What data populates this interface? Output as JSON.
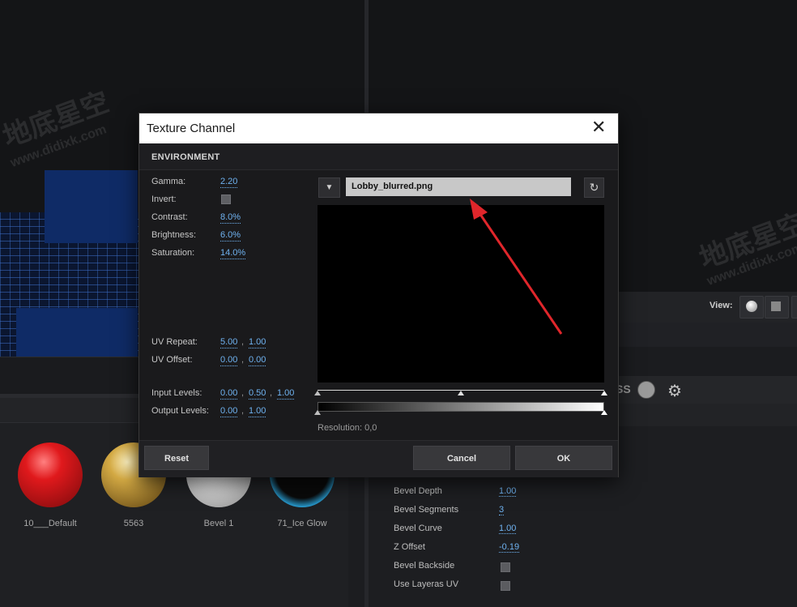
{
  "dialog": {
    "title": "Texture Channel",
    "close_glyph": "✕",
    "section": "ENVIRONMENT",
    "gamma_label": "Gamma:",
    "gamma": "2.20",
    "invert_label": "Invert:",
    "invert_checked": false,
    "contrast_label": "Contrast:",
    "contrast": "8.0%",
    "brightness_label": "Brightness:",
    "brightness": "6.0%",
    "saturation_label": "Saturation:",
    "saturation": "14.0%",
    "uv_repeat_label": "UV Repeat:",
    "uv_repeat_u": "5.00",
    "uv_repeat_v": "1.00",
    "uv_offset_label": "UV Offset:",
    "uv_offset_u": "0.00",
    "uv_offset_v": "0.00",
    "input_levels_label": "Input Levels:",
    "input_levels_black": "0.00",
    "input_levels_mid": "0.50",
    "input_levels_white": "1.00",
    "output_levels_label": "Output Levels:",
    "output_levels_black": "0.00",
    "output_levels_white": "1.00",
    "separator": ",",
    "file_name": "Lobby_blurred.png",
    "dropdown_glyph": "▼",
    "refresh_glyph": "↻",
    "resolution": "Resolution: 0,0",
    "reset_label": "Reset",
    "cancel_label": "Cancel",
    "ok_label": "OK"
  },
  "materials": [
    {
      "name": "10___Default",
      "color": "#e0191c"
    },
    {
      "name": "5563",
      "color": "#c9a23c"
    },
    {
      "name": "Bevel 1",
      "color": "#e6e6e6"
    },
    {
      "name": "71_Ice Glow",
      "color": "#2aa7e0"
    }
  ],
  "right_panel": {
    "view_label": "View:",
    "partial_text": "SS",
    "properties": [
      {
        "label": "Bevel Depth",
        "value": "1.00"
      },
      {
        "label": "Bevel Segments",
        "value": "3"
      },
      {
        "label": "Bevel Curve",
        "value": "1.00"
      },
      {
        "label": "Z Offset",
        "value": "-0.19"
      },
      {
        "label": "Bevel Backside",
        "value": null
      },
      {
        "label": "Use Layeras UV",
        "value": null
      }
    ]
  },
  "watermark": {
    "cn": "地底星空",
    "url": "www.didixk.com"
  },
  "colors": {
    "accent_value": "#6fb2f0",
    "annotation_arrow": "#e0262b"
  },
  "icons": [
    "close-icon",
    "chevron-down-icon",
    "refresh-icon",
    "gear-icon",
    "sphere-icon"
  ]
}
